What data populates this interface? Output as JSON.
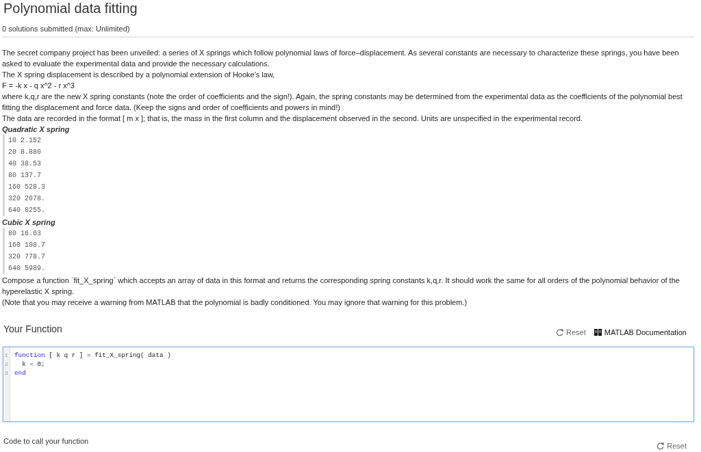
{
  "problem": {
    "title": "Polynomial data fitting",
    "submissions": "0 solutions submitted (max: Unlimited)"
  },
  "description": [
    {
      "kind": "paragraph",
      "text": "The secret company project has been unveiled: a series of X springs which follow polynomial laws of force–displacement. As several constants are necessary to characterize these springs, you have been asked to evaluate the experimental data and provide the necessary calculations."
    },
    {
      "kind": "paragraph",
      "text": "The X spring displacement is described by a polynomial extension of Hooke's law,"
    },
    {
      "kind": "paragraph",
      "text": "F = -k x - q x^2 - r x^3"
    },
    {
      "kind": "paragraph",
      "text": "where k,q,r are the new X spring constants (note the order of coefficients and the sign!). Again, the spring constants may be determined from the experimental data as the coefficients of the polynomial best fitting the displacement and force data. (Keep the signs and order of coefficients and powers in mind!)"
    },
    {
      "kind": "paragraph",
      "text": "The data are recorded in the format [ m x ]; that is, the mass in the first column and the displacement observed in the second. Units are unspecified in the experimental record."
    },
    {
      "kind": "heading",
      "text": "Quadratic X spring"
    },
    {
      "kind": "data",
      "lines": [
        "10 2.152",
        "20 8.880",
        "40 38.53",
        "80 137.7",
        "160 528.3",
        "320 2078.",
        "640 8255."
      ]
    },
    {
      "kind": "heading",
      "text": "Cubic X spring"
    },
    {
      "kind": "data",
      "lines": [
        "80 16.63",
        "160 108.7",
        "320 778.7",
        "640 5989."
      ]
    },
    {
      "kind": "paragraph",
      "text": "Compose a function `fit_X_spring` which accepts an array of data in this format and returns the corresponding spring constants k,q,r. It should work the same for all orders of the polynomial behavior of the hyperelastic X spring."
    },
    {
      "kind": "paragraph",
      "text": "(Note that you may receive a warning from MATLAB that the polynomial is badly conditioned. You may ignore that warning for this problem.)"
    }
  ],
  "function_section": {
    "title": "Your Function",
    "actions": [
      {
        "kind": "reset",
        "label": "Reset"
      },
      {
        "kind": "docs",
        "label": "MATLAB Documentation"
      }
    ],
    "editor": {
      "focused": true,
      "lines": [
        {
          "number": "1",
          "tokens": [
            {
              "kind": "keyword",
              "text": "function"
            },
            {
              "kind": "plain",
              "text": " [ k q r ] = fit_X_spring( data )"
            }
          ]
        },
        {
          "number": "2",
          "tokens": [
            {
              "kind": "plain",
              "text": "  k = 0;"
            }
          ]
        },
        {
          "number": "3",
          "tokens": [
            {
              "kind": "keyword",
              "text": "end"
            }
          ]
        }
      ]
    }
  },
  "call_section": {
    "title": "Code to call your function",
    "actions": [
      {
        "kind": "reset",
        "label": "Reset"
      }
    ]
  }
}
